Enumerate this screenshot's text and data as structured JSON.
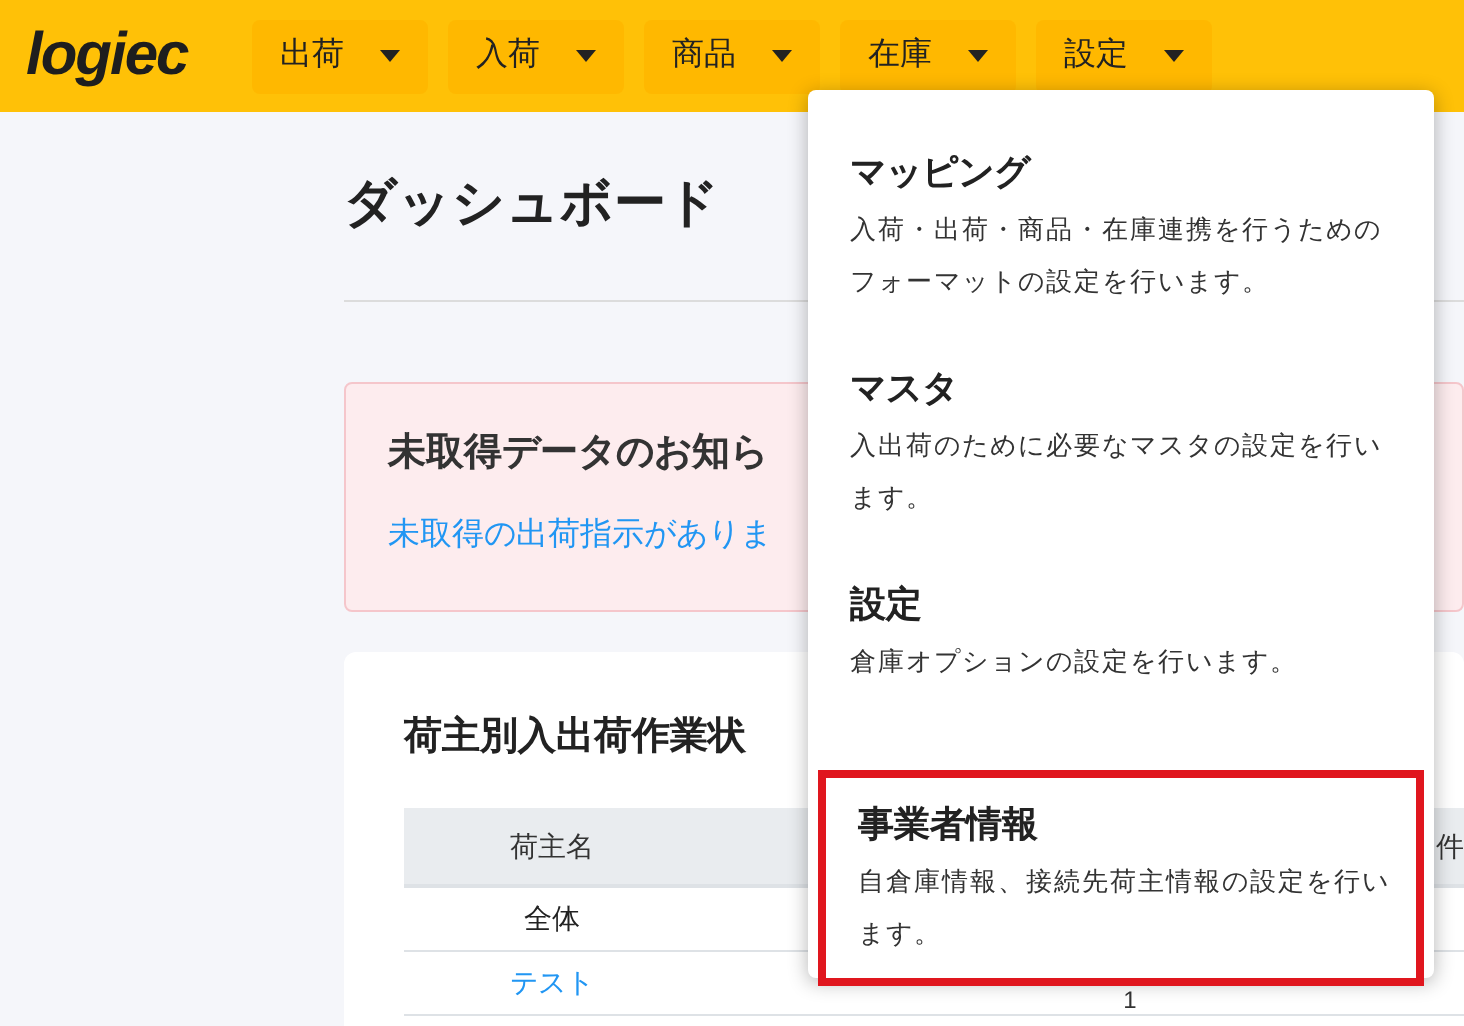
{
  "logo": {
    "text": "logiec"
  },
  "nav": [
    {
      "label": "出荷"
    },
    {
      "label": "入荷"
    },
    {
      "label": "商品"
    },
    {
      "label": "在庫"
    },
    {
      "label": "設定"
    }
  ],
  "menu": [
    {
      "title": "マッピング",
      "description": "入荷・出荷・商品・在庫連携を行うためのフォーマットの設定を行います。",
      "selected": false
    },
    {
      "title": "マスタ",
      "description": "入出荷のために必要なマスタの設定を行います。",
      "selected": false
    },
    {
      "title": "設定",
      "description": "倉庫オプションの設定を行います。",
      "selected": false
    },
    {
      "title": "事業者情報",
      "description": "自倉庫情報、接続先荷主情報の設定を行います。",
      "selected": true
    }
  ],
  "page_title": "ダッシュボード",
  "alert": {
    "title": "未取得データのお知ら",
    "link": "未取得の出荷指示がありま"
  },
  "card": {
    "title": "荷主別入出荷作業状",
    "table": {
      "column_1": "荷主名",
      "column_4": "件",
      "rows": [
        {
          "name": "全体",
          "kind": "text"
        },
        {
          "name": "テスト",
          "kind": "link",
          "column_3": "1"
        }
      ]
    }
  }
}
